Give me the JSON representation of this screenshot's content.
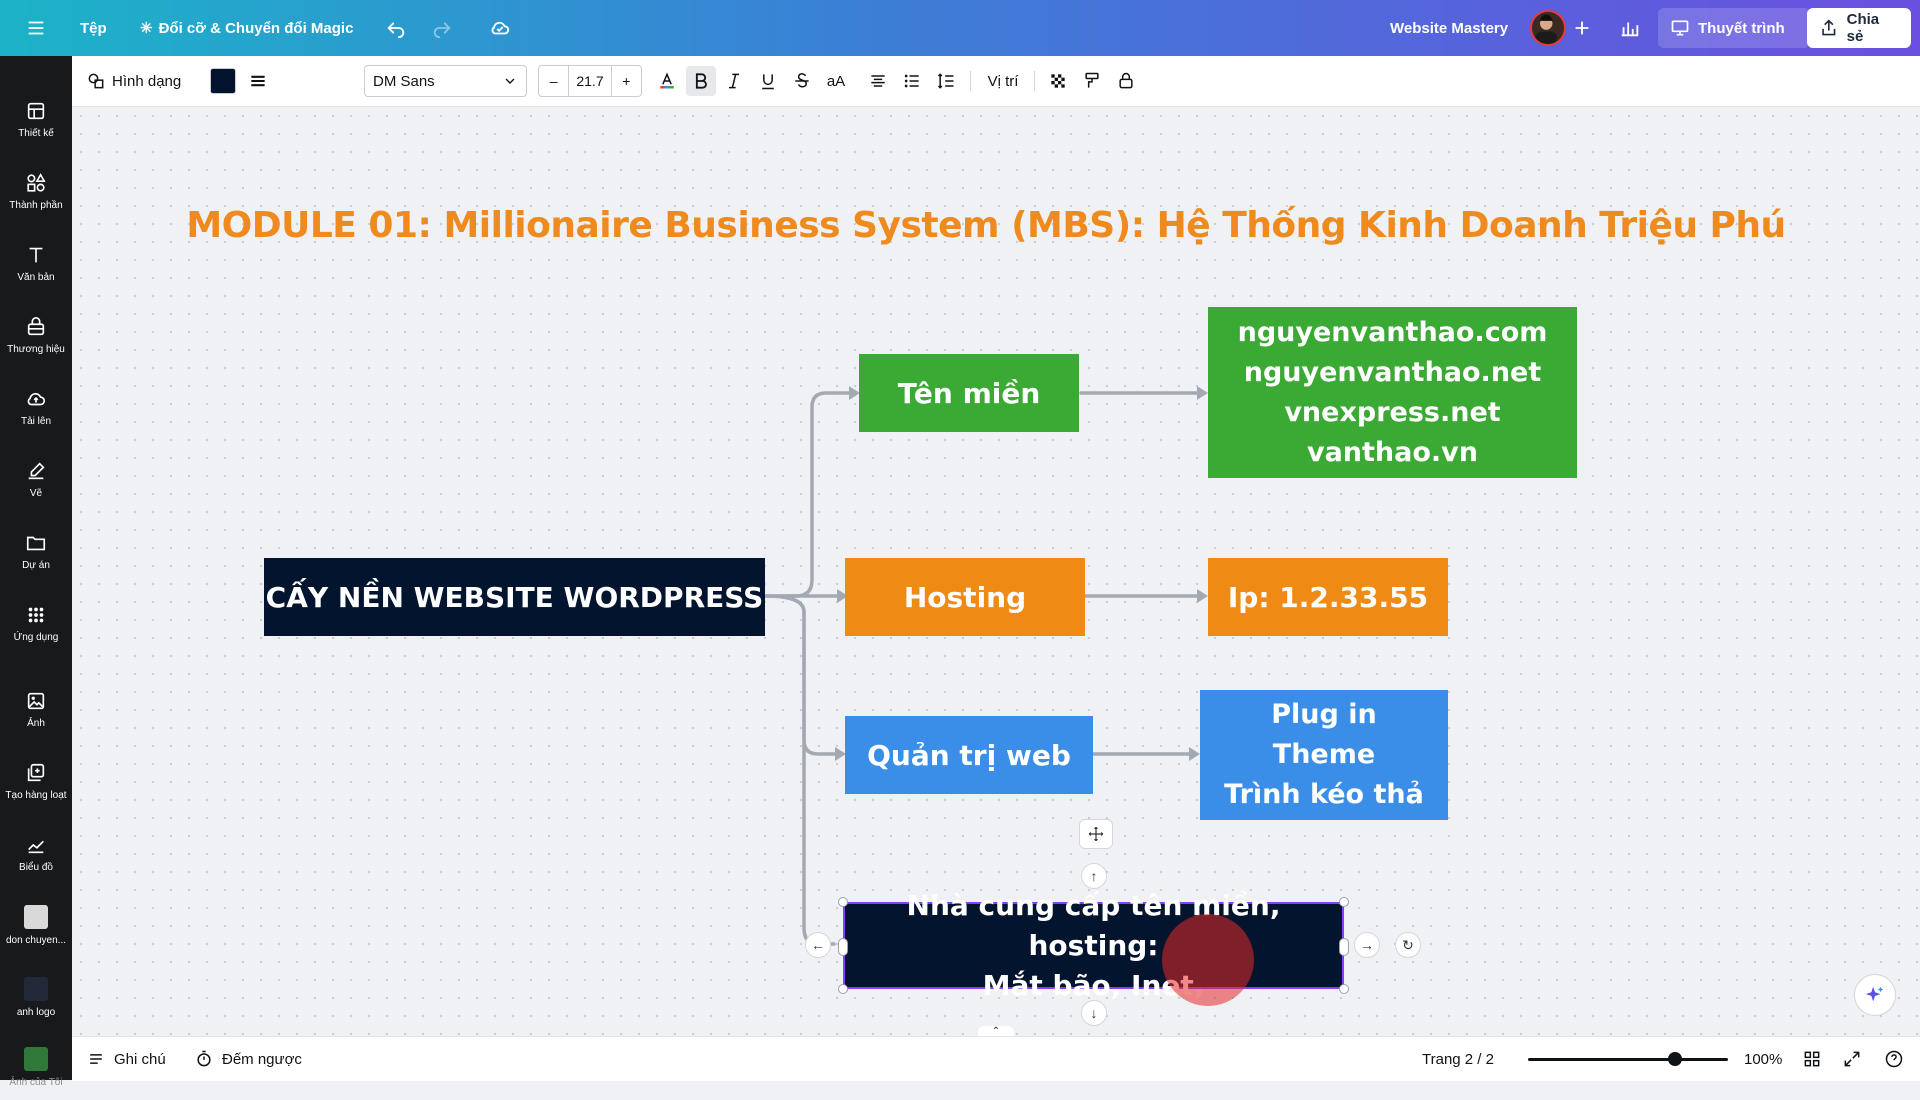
{
  "topbar": {
    "menu_icon": "hamburger-menu-icon",
    "file_label": "Tệp",
    "magic_label": "Đổi cỡ & Chuyển đổi Magic",
    "project_name": "Website Mastery",
    "present_label": "Thuyết trình",
    "share_label": "Chia sẻ"
  },
  "sidebar": {
    "items": [
      {
        "label": "Thiết kế",
        "icon": "layout-icon"
      },
      {
        "label": "Thành phần",
        "icon": "shapes-icon"
      },
      {
        "label": "Văn bản",
        "icon": "text-icon"
      },
      {
        "label": "Thương hiệu",
        "icon": "brand-icon"
      },
      {
        "label": "Tải lên",
        "icon": "upload-cloud-icon"
      },
      {
        "label": "Vẽ",
        "icon": "pen-icon"
      },
      {
        "label": "Dự án",
        "icon": "folder-icon"
      },
      {
        "label": "Ứng dụng",
        "icon": "apps-grid-icon"
      },
      {
        "label": "Ảnh",
        "icon": "image-icon"
      },
      {
        "label": "Tạo hàng loạt",
        "icon": "bulk-create-icon"
      },
      {
        "label": "Biểu đồ",
        "icon": "chart-icon"
      },
      {
        "label": "don chuyen...",
        "icon": "custom-app-thumbnail"
      },
      {
        "label": "anh logo",
        "icon": "logo-thumbnail"
      },
      {
        "label": "Ảnh của Tôi",
        "icon": "my-photos-thumbnail"
      }
    ]
  },
  "toolbar": {
    "shape_label": "Hình dạng",
    "font_name": "DM Sans",
    "font_size": "21.7",
    "minus": "–",
    "plus": "+",
    "case_label": "aA",
    "position_label": "Vị trí",
    "fill_color": "#03142e"
  },
  "canvas": {
    "title": "MODULE 01: Millionaire Business System (MBS): Hệ Thống Kinh Doanh Triệu Phú",
    "root": "CẤY NỀN WEBSITE WORDPRESS",
    "nodes": {
      "domain": "Tên miền",
      "hosting": "Hosting",
      "admin": "Quản trị web"
    },
    "details": {
      "domain_lines": [
        "nguyenvanthao.com",
        "nguyenvanthao.net",
        "vnexpress.net",
        "vanthao.vn"
      ],
      "hosting": "Ip: 1.2.33.55",
      "admin_lines": [
        "Plug in",
        "Theme",
        "Trình kéo thả"
      ]
    },
    "selected_box": {
      "line1": "Nhà cung cấp tên miền, hosting:",
      "line2": "Mắt bão, Inet,"
    }
  },
  "bottombar": {
    "notes_label": "Ghi chú",
    "timer_label": "Đếm ngược",
    "page_label": "Trang 2 / 2",
    "zoom_label": "100%",
    "zoom_level_percent": 100
  },
  "colors": {
    "title": "#ee8a1e",
    "green": "#3aaa35",
    "orange": "#ef8a14",
    "blue": "#3a8ee8",
    "navy": "#03142e",
    "connector": "#a3a9b3"
  }
}
